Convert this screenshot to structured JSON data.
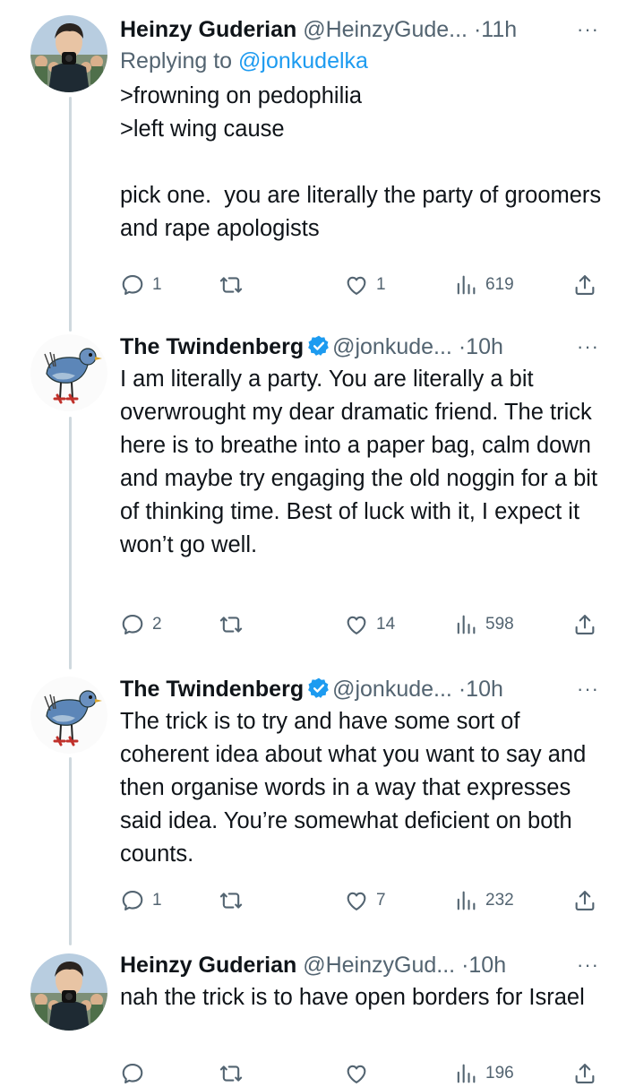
{
  "tweets": [
    {
      "author": "Heinzy Guderian",
      "handle": "@HeinzyGude...",
      "time": "11h",
      "verified": false,
      "reply_prefix": "Replying to ",
      "reply_to": "@jonkudelka",
      "text": ">frowning on pedophilia\n>left wing cause\n\npick one.  you are literally the party of groomers and rape apologists",
      "replies": "1",
      "retweets": "",
      "likes": "1",
      "views": "619"
    },
    {
      "author": "The Twindenberg",
      "handle": "@jonkude...",
      "time": "10h",
      "verified": true,
      "text": "I am literally a party. You are literally a bit overwrought my dear dramatic friend. The trick here is to breathe into a paper bag, calm down and maybe try engaging the old noggin for a bit of thinking time. Best of luck with it, I expect it won’t go well.",
      "replies": "2",
      "retweets": "",
      "likes": "14",
      "views": "598"
    },
    {
      "author": "The Twindenberg",
      "handle": "@jonkude...",
      "time": "10h",
      "verified": true,
      "text": "The trick is to try and have some sort of coherent idea about what you want to say and then organise words in a way that expresses said idea. You’re somewhat deficient on both counts.",
      "replies": "1",
      "retweets": "",
      "likes": "7",
      "views": "232"
    },
    {
      "author": "Heinzy Guderian",
      "handle": "@HeinzyGud...",
      "time": "10h",
      "verified": false,
      "text": "nah the trick is to have open borders for Israel",
      "replies": "",
      "retweets": "",
      "likes": "",
      "views": "196"
    }
  ],
  "separator": "·",
  "more": "···",
  "icons": [
    "reply-icon",
    "retweet-icon",
    "like-icon",
    "views-icon",
    "share-icon",
    "verified-badge-icon"
  ],
  "colors": {
    "text": "#0f1419",
    "muted": "#536471",
    "link": "#1d9bf0",
    "thread_line": "#cfd9de"
  }
}
